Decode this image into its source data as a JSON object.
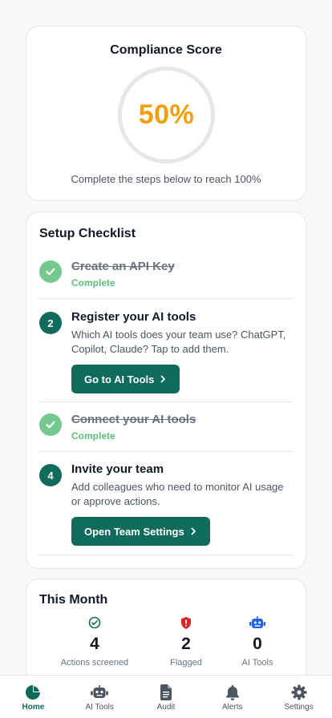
{
  "score": {
    "title": "Compliance Score",
    "value": "50%",
    "percent": 50,
    "subtitle": "Complete the steps below to reach 100%"
  },
  "checklist": {
    "title": "Setup Checklist",
    "steps": [
      {
        "number": "1",
        "title": "Create an API Key",
        "status": "Complete",
        "done": true
      },
      {
        "number": "2",
        "title": "Register your AI tools",
        "description": "Which AI tools does your team use? ChatGPT, Copilot, Claude? Tap to add them.",
        "button": "Go to AI Tools",
        "done": false
      },
      {
        "number": "3",
        "title": "Connect your AI tools",
        "status": "Complete",
        "done": true
      },
      {
        "number": "4",
        "title": "Invite your team",
        "description": "Add colleagues who need to monitor AI usage or approve actions.",
        "button": "Open Team Settings",
        "done": false
      }
    ]
  },
  "month": {
    "title": "This Month",
    "stats": [
      {
        "value": "4",
        "label": "Actions screened",
        "icon": "check-circle-icon",
        "color": "#0f6b5c"
      },
      {
        "value": "2",
        "label": "Flagged",
        "icon": "shield-alert-icon",
        "color": "#dc2626"
      },
      {
        "value": "0",
        "label": "AI Tools",
        "icon": "robot-icon",
        "color": "#2563eb"
      }
    ]
  },
  "nav": {
    "items": [
      {
        "label": "Home",
        "icon": "home-pie-icon",
        "active": true
      },
      {
        "label": "AI Tools",
        "icon": "robot-icon",
        "active": false
      },
      {
        "label": "Audit",
        "icon": "document-icon",
        "active": false
      },
      {
        "label": "Alerts",
        "icon": "bell-icon",
        "active": false
      },
      {
        "label": "Settings",
        "icon": "gear-icon",
        "active": false
      }
    ]
  },
  "colors": {
    "primary": "#0f6b5c",
    "score": "#f59e0b",
    "complete": "#5cbf7c",
    "danger": "#dc2626",
    "info": "#2563eb"
  }
}
